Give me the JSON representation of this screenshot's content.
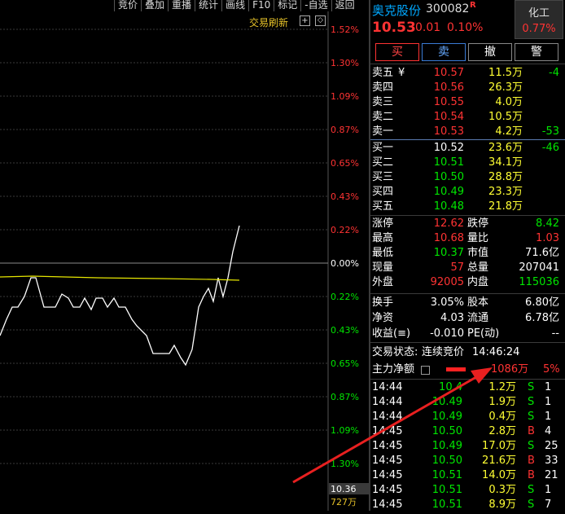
{
  "toolbar": [
    "竞价",
    "叠加",
    "重播",
    "统计",
    "画线",
    "F10",
    "标记",
    "-自选",
    "返回"
  ],
  "chart": {
    "refresh_label": "交易刷新",
    "refresh_icon": "plus-box-icon",
    "scale_icon": "expand-icon",
    "pct_labels": [
      "1.52%",
      "1.30%",
      "1.09%",
      "0.87%",
      "0.65%",
      "0.43%",
      "0.22%",
      "0.00%",
      "0.22%",
      "0.43%",
      "0.65%",
      "0.87%",
      "1.09%",
      "1.30%"
    ],
    "pct_colors": [
      "red",
      "red",
      "red",
      "red",
      "red",
      "red",
      "red",
      "white",
      "green",
      "green",
      "green",
      "green",
      "green",
      "green"
    ],
    "bottom_price": "10.36",
    "bottom_volume": "727万"
  },
  "header": {
    "stock_name": "奥克股份",
    "stock_code": "300082",
    "r_badge": "R",
    "price": "10.53",
    "change": "0.01",
    "change_pct": "0.10%",
    "sector_name": "化工",
    "sector_pct": "0.77%"
  },
  "actions": {
    "buy": "买",
    "sell": "卖",
    "cancel": "撤",
    "alert": "警"
  },
  "asks": [
    {
      "label": "卖五",
      "extra": "¥",
      "price": "10.57",
      "vol": "11.5万",
      "delta": "-4",
      "delta_color": "green"
    },
    {
      "label": "卖四",
      "extra": "",
      "price": "10.56",
      "vol": "26.3万",
      "delta": "",
      "delta_color": "green"
    },
    {
      "label": "卖三",
      "extra": "",
      "price": "10.55",
      "vol": "4.0万",
      "delta": "",
      "delta_color": "green"
    },
    {
      "label": "卖二",
      "extra": "",
      "price": "10.54",
      "vol": "10.5万",
      "delta": "",
      "delta_color": "green"
    },
    {
      "label": "卖一",
      "extra": "",
      "price": "10.53",
      "vol": "4.2万",
      "delta": "-53",
      "delta_color": "green"
    }
  ],
  "bids": [
    {
      "label": "买一",
      "price": "10.52",
      "price_color": "white",
      "vol": "23.6万",
      "delta": "-46",
      "delta_color": "green"
    },
    {
      "label": "买二",
      "price": "10.51",
      "price_color": "green",
      "vol": "34.1万",
      "delta": "",
      "delta_color": "green"
    },
    {
      "label": "买三",
      "price": "10.50",
      "price_color": "green",
      "vol": "28.8万",
      "delta": "",
      "delta_color": "green"
    },
    {
      "label": "买四",
      "price": "10.49",
      "price_color": "green",
      "vol": "23.3万",
      "delta": "",
      "delta_color": "green"
    },
    {
      "label": "买五",
      "price": "10.48",
      "price_color": "green",
      "vol": "21.8万",
      "delta": "",
      "delta_color": "green"
    }
  ],
  "stats": [
    {
      "l1": "涨停",
      "v1": "12.62",
      "c1": "red",
      "l2": "跌停",
      "v2": "8.42",
      "c2": "green"
    },
    {
      "l1": "最高",
      "v1": "10.68",
      "c1": "red",
      "l2": "量比",
      "v2": "1.03",
      "c2": "red"
    },
    {
      "l1": "最低",
      "v1": "10.37",
      "c1": "green",
      "l2": "市值",
      "v2": "71.6亿",
      "c2": "white"
    },
    {
      "l1": "现量",
      "v1": "57",
      "c1": "red",
      "l2": "总量",
      "v2": "207041",
      "c2": "white"
    },
    {
      "l1": "外盘",
      "v1": "92005",
      "c1": "red",
      "l2": "内盘",
      "v2": "115036",
      "c2": "green"
    }
  ],
  "fundamentals": [
    {
      "l1": "换手",
      "v1": "3.05%",
      "l2": "股本",
      "v2": "6.80亿"
    },
    {
      "l1": "净资",
      "v1": "4.03",
      "l2": "流通",
      "v2": "6.78亿"
    },
    {
      "l1": "收益(≡)",
      "v1": "-0.010",
      "l2": "PE(动)",
      "v2": "--"
    }
  ],
  "trade_status": {
    "label": "交易状态:",
    "value": "连续竞价",
    "time": "14:46:24"
  },
  "main_flow": {
    "label": "主力净额",
    "icon": "list-icon",
    "value": "1086万",
    "pct": "5%"
  },
  "ticks": [
    {
      "time": "14:44",
      "price": "10.4",
      "price_color": "green",
      "vol": "1.2万",
      "side": "S",
      "side_color": "green",
      "count": "1"
    },
    {
      "time": "14:44",
      "price": "10.49",
      "price_color": "green",
      "vol": "1.9万",
      "side": "S",
      "side_color": "green",
      "count": "1"
    },
    {
      "time": "14:44",
      "price": "10.49",
      "price_color": "green",
      "vol": "0.4万",
      "side": "S",
      "side_color": "green",
      "count": "1"
    },
    {
      "time": "14:45",
      "price": "10.50",
      "price_color": "green",
      "vol": "2.8万",
      "side": "B",
      "side_color": "red",
      "count": "4"
    },
    {
      "time": "14:45",
      "price": "10.49",
      "price_color": "green",
      "vol": "17.0万",
      "side": "S",
      "side_color": "green",
      "count": "25"
    },
    {
      "time": "14:45",
      "price": "10.50",
      "price_color": "green",
      "vol": "21.6万",
      "side": "B",
      "side_color": "red",
      "count": "33"
    },
    {
      "time": "14:45",
      "price": "10.51",
      "price_color": "green",
      "vol": "14.0万",
      "side": "B",
      "side_color": "red",
      "count": "21"
    },
    {
      "time": "14:45",
      "price": "10.51",
      "price_color": "green",
      "vol": "0.3万",
      "side": "S",
      "side_color": "green",
      "count": "1"
    },
    {
      "time": "14:45",
      "price": "10.51",
      "price_color": "green",
      "vol": "8.9万",
      "side": "S",
      "side_color": "green",
      "count": "7"
    }
  ],
  "colors": {
    "up": "#ff3333",
    "down": "#00e600",
    "price_line": "#ffffff",
    "avg_line": "#e6e600",
    "arrow": "#e82020"
  }
}
